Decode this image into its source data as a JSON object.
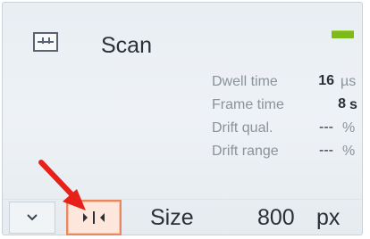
{
  "panel": {
    "title": "Scan",
    "icon": "scan-icon",
    "status_color": "#7dbb1d"
  },
  "params": [
    {
      "label": "Dwell time",
      "value": "16",
      "unit": "µs"
    },
    {
      "label": "Frame time",
      "value": "8",
      "unit": "s"
    },
    {
      "label": "Drift qual.",
      "value": "---",
      "unit": "%"
    },
    {
      "label": "Drift range",
      "value": "---",
      "unit": "%"
    }
  ],
  "controls": {
    "expand_icon": "chevron-down-icon",
    "fit_icon": "fit-width-icon",
    "size_label": "Size",
    "size_value": "800",
    "size_unit": "px"
  },
  "annotation": {
    "arrow_color": "#e8201a"
  }
}
